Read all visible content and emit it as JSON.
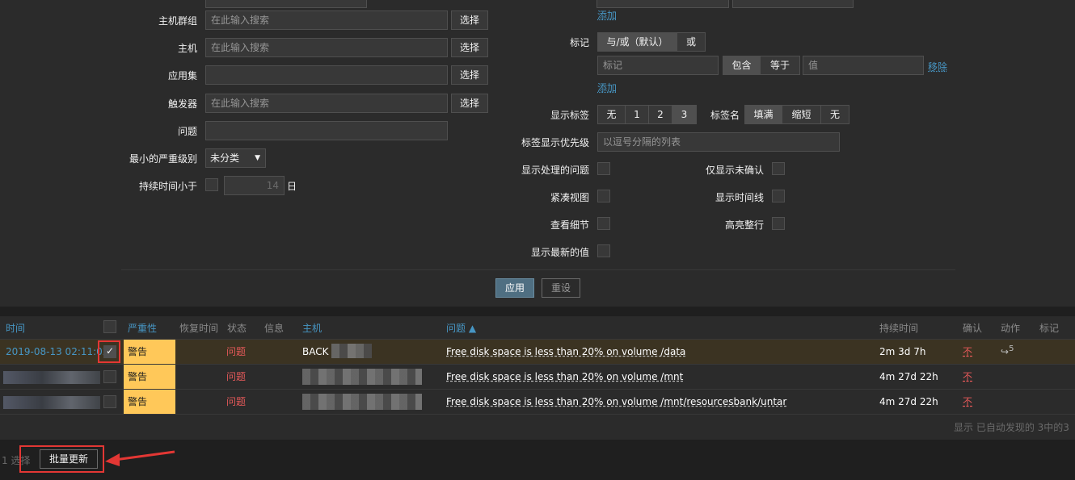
{
  "filter": {
    "host_groups": {
      "label": "主机群组",
      "placeholder": "在此输入搜索",
      "button": "选择"
    },
    "hosts": {
      "label": "主机",
      "placeholder": "在此输入搜索",
      "button": "选择"
    },
    "application": {
      "label": "应用集",
      "value": "",
      "button": "选择"
    },
    "triggers": {
      "label": "触发器",
      "placeholder": "在此输入搜索",
      "button": "选择"
    },
    "problem": {
      "label": "问题",
      "value": ""
    },
    "min_severity": {
      "label": "最小的严重级别",
      "value": "未分类"
    },
    "age_less": {
      "label": "持续时间小于",
      "value": "14",
      "unit": "日"
    },
    "add_link_top": "添加",
    "tags": {
      "label": "标记",
      "eval_options": [
        "与/或（默认）",
        "或"
      ],
      "tag_placeholder": "标记",
      "operator_options": [
        "包含",
        "等于"
      ],
      "value_placeholder": "值",
      "remove_link": "移除",
      "add_link": "添加"
    },
    "show_tags": {
      "label": "显示标签",
      "options": [
        "无",
        "1",
        "2",
        "3"
      ]
    },
    "tag_name": {
      "label": "标签名",
      "options": [
        "填满",
        "缩短",
        "无"
      ]
    },
    "tag_priority": {
      "label": "标签显示优先级",
      "placeholder": "以逗号分隔的列表"
    },
    "show_suppressed": {
      "label": "显示处理的问题"
    },
    "unacknowledged": {
      "label": "仅显示未确认"
    },
    "compact_view": {
      "label": "紧凑视图"
    },
    "show_timeline": {
      "label": "显示时间线"
    },
    "show_details": {
      "label": "查看细节"
    },
    "highlight_row": {
      "label": "高亮整行"
    },
    "show_latest": {
      "label": "显示最新的值"
    },
    "apply": "应用",
    "reset": "重设"
  },
  "table": {
    "headers": {
      "time": "时间",
      "severity": "严重性",
      "recovery": "恢复时间",
      "status": "状态",
      "info": "信息",
      "host": "主机",
      "problem": "问题 ▲",
      "duration": "持续时间",
      "ack": "确认",
      "actions": "动作",
      "tags": "标记"
    },
    "rows": [
      {
        "time": "2019-08-13 02:11:02",
        "severity": "警告",
        "status": "问题",
        "host": "BACK",
        "problem": "Free disk space is less than 20% on volume /data",
        "duration": "2m 3d 7h",
        "ack": "不",
        "actions": "5"
      },
      {
        "time": "",
        "severity": "警告",
        "status": "问题",
        "host": "",
        "problem": "Free disk space is less than 20% on volume /mnt",
        "duration": "4m 27d 22h",
        "ack": "不",
        "actions": ""
      },
      {
        "time": "",
        "severity": "警告",
        "status": "问题",
        "host": "",
        "problem": "Free disk space is less than 20% on volume /mnt/resourcesbank/untar",
        "duration": "4m 27d 22h",
        "ack": "不",
        "actions": ""
      }
    ],
    "summary": "显示 已自动发现的 3中的3"
  },
  "footer": {
    "selected": "1 选择",
    "mass_update": "批量更新"
  },
  "colors": {
    "accent": "#4796c4",
    "warning": "#ffc859",
    "problem": "#e45959",
    "annotation": "#e33734"
  }
}
